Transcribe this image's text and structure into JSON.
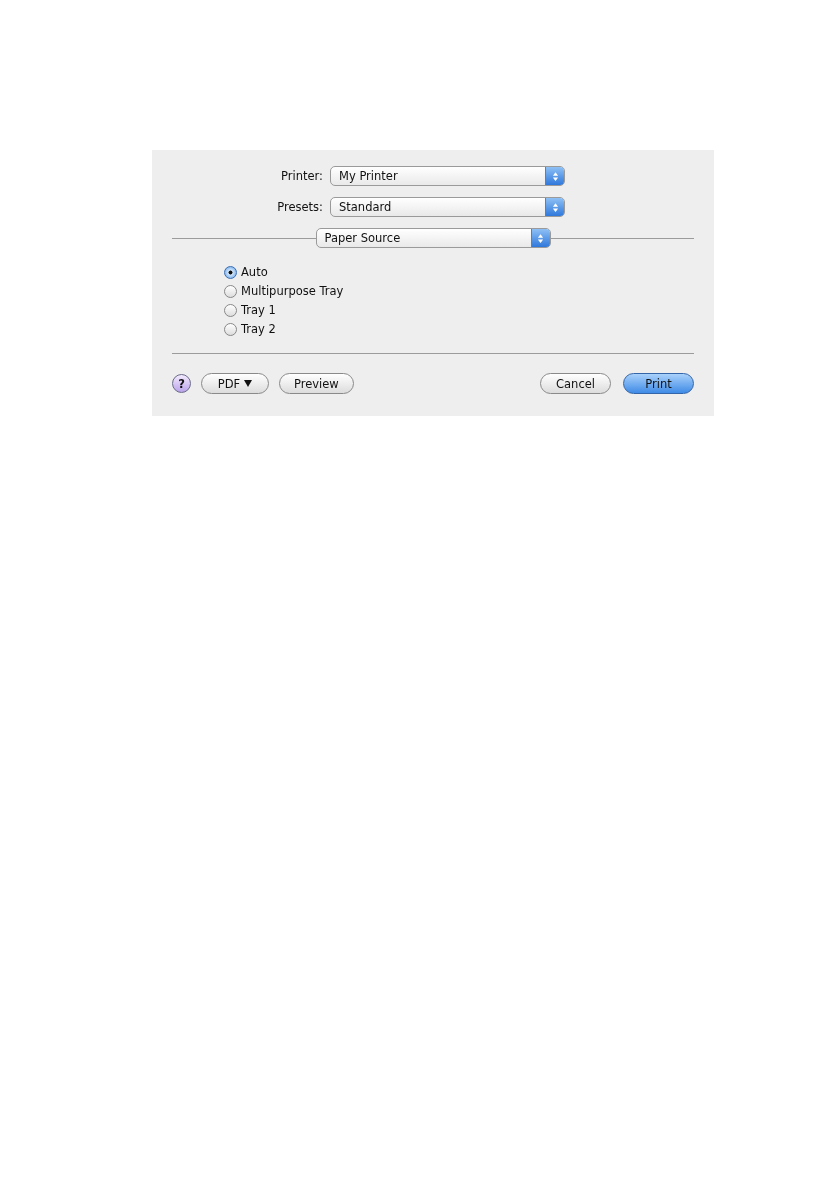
{
  "popups": [
    {
      "label": "Printer:",
      "value": "My Printer"
    },
    {
      "label": "Presets:",
      "value": "Standard"
    }
  ],
  "panel_popup": {
    "value": "Paper Source"
  },
  "radios": [
    {
      "label": "Auto",
      "selected": true
    },
    {
      "label": "Multipurpose Tray",
      "selected": false
    },
    {
      "label": "Tray 1",
      "selected": false
    },
    {
      "label": "Tray 2",
      "selected": false
    }
  ],
  "left_buttons": [
    {
      "kind": "help",
      "label": "?"
    },
    {
      "kind": "menu",
      "label": "PDF"
    },
    {
      "kind": "normal",
      "label": "Preview"
    }
  ],
  "right_buttons": [
    {
      "kind": "normal",
      "label": "Cancel"
    },
    {
      "kind": "default",
      "label": "Print"
    }
  ]
}
